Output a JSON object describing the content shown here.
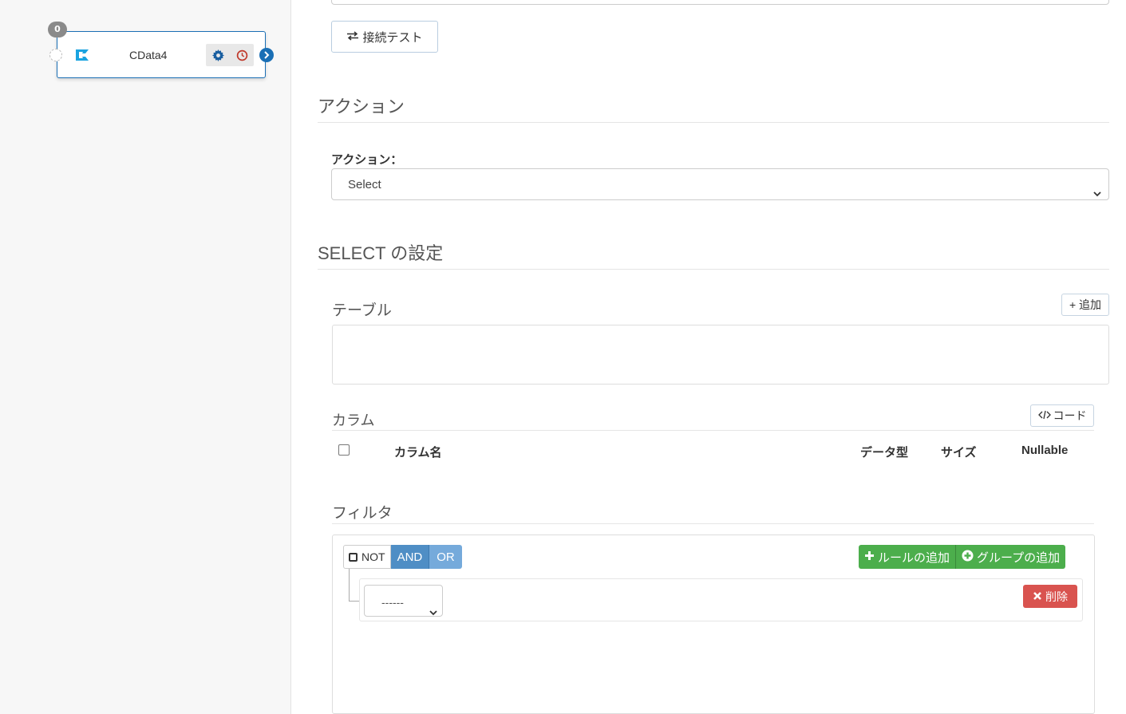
{
  "canvas": {
    "node": {
      "badge": "0",
      "name": "CData4",
      "accent": "#1a6fb5",
      "icons": [
        "cdata-logo-icon",
        "gear-icon",
        "clock-icon",
        "chevron-right-icon"
      ]
    }
  },
  "panel": {
    "connection_test_label": "接続テスト",
    "action_section_title": "アクション",
    "action_label": "アクション：",
    "action_select_value": "Select",
    "select_settings_title": "SELECT の設定",
    "table": {
      "title": "テーブル",
      "add_label": "+ 追加"
    },
    "columns": {
      "title": "カラム",
      "code_label": "コード",
      "headers": {
        "name": "カラム名",
        "datatype": "データ型",
        "size": "サイズ",
        "nullable": "Nullable"
      }
    },
    "filter": {
      "title": "フィルタ",
      "not_label": "NOT",
      "and_label": "AND",
      "or_label": "OR",
      "add_rule_label": "ルールの追加",
      "add_group_label": "グループの追加",
      "rule_select_value": "------",
      "delete_label": "削除",
      "colors": {
        "and": "#4f8ec5",
        "or": "#75aadb",
        "add": "#4cae4c",
        "delete": "#d9534f"
      }
    }
  }
}
